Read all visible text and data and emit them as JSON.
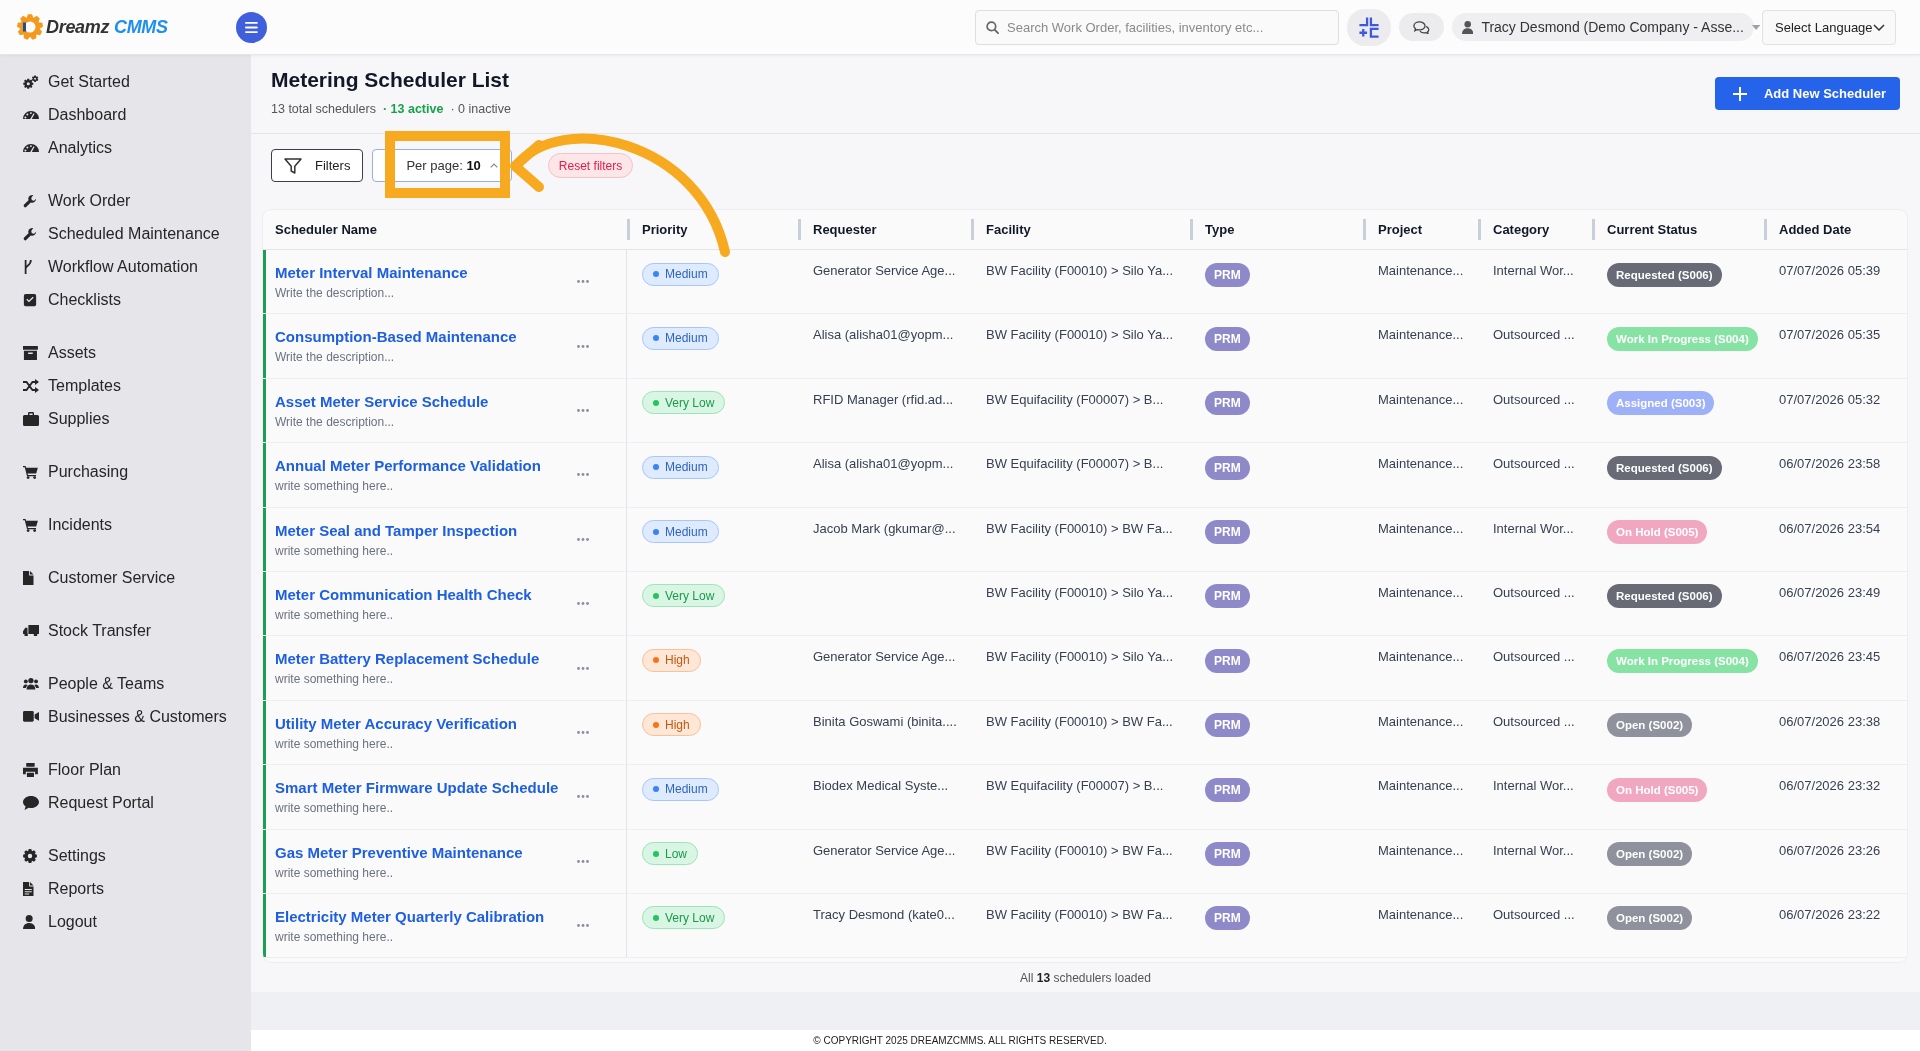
{
  "header": {
    "logo": {
      "name": "Dreamz",
      "accent": "CMMS"
    },
    "search": {
      "placeholder": "Search Work Order, facilities, inventory etc..."
    },
    "user": {
      "name": "Tracy Desmond (Demo Company - Asse..."
    },
    "language": {
      "value": "Select Language"
    }
  },
  "sidebar": {
    "groups": [
      {
        "items": [
          {
            "label": "Get Started"
          },
          {
            "label": "Dashboard"
          },
          {
            "label": "Analytics"
          }
        ]
      },
      {
        "items": [
          {
            "label": "Work Order"
          },
          {
            "label": "Scheduled Maintenance"
          },
          {
            "label": "Workflow Automation"
          },
          {
            "label": "Checklists"
          }
        ]
      },
      {
        "items": [
          {
            "label": "Assets"
          },
          {
            "label": "Templates"
          },
          {
            "label": "Supplies"
          }
        ]
      },
      {
        "items": [
          {
            "label": "Purchasing"
          }
        ]
      },
      {
        "items": [
          {
            "label": "Incidents"
          }
        ]
      },
      {
        "items": [
          {
            "label": "Customer Service"
          }
        ]
      },
      {
        "items": [
          {
            "label": "Stock Transfer"
          }
        ]
      },
      {
        "items": [
          {
            "label": "People & Teams"
          },
          {
            "label": "Businesses & Customers"
          }
        ]
      },
      {
        "items": [
          {
            "label": "Floor Plan"
          },
          {
            "label": "Request Portal"
          }
        ]
      },
      {
        "items": [
          {
            "label": "Settings"
          },
          {
            "label": "Reports"
          },
          {
            "label": "Logout"
          }
        ]
      }
    ]
  },
  "page": {
    "title": "Metering Scheduler List",
    "stats": [
      {
        "kind": "total",
        "text": "13 total schedulers"
      },
      {
        "kind": "active",
        "text": "· 13 active"
      },
      {
        "kind": "inactive",
        "text": "· 0 inactive"
      }
    ],
    "add_button": "Add New Scheduler"
  },
  "toolbar": {
    "filters": "Filters",
    "per_page": "Per page: **10**",
    "reset": "Reset filters"
  },
  "table": {
    "columns": [
      "Scheduler Name",
      "Priority",
      "Requester",
      "Facility",
      "Type",
      "Project",
      "Category",
      "Current Status",
      "Added Date"
    ],
    "rows": [
      {
        "active": true,
        "name": "Meter Interval Maintenance",
        "description": "Write the description...",
        "priority": {
          "label": "Medium",
          "color": "#3b82f6"
        },
        "requester": "Generator Service Age...",
        "facility": "BW Facility (F00010) > Silo Ya...",
        "type": "PRM",
        "project": "Maintenance...",
        "category": "Internal Wor...",
        "status": {
          "label": "Requested (S006)",
          "color": "#686b76"
        },
        "added": "07/07/2026 05:39"
      },
      {
        "active": true,
        "name": "Consumption-Based Maintenance",
        "description": "Write the description...",
        "priority": {
          "label": "Medium",
          "color": "#3b82f6"
        },
        "requester": "Alisa (alisha01@yopm...",
        "facility": "BW Facility (F00010) > Silo Ya...",
        "type": "PRM",
        "project": "Maintenance...",
        "category": "Outsourced ...",
        "status": {
          "label": "Work In Progress (S004)",
          "color": "#86e3a4"
        },
        "added": "07/07/2026 05:35"
      },
      {
        "active": true,
        "name": "Asset Meter Service Schedule",
        "description": "Write the description...",
        "priority": {
          "label": "Very Low",
          "color": "#22c55e"
        },
        "requester": "RFID Manager (rfid.ad...",
        "facility": "BW Equifacility (F00007) > B...",
        "type": "PRM",
        "project": "Maintenance...",
        "category": "Outsourced ...",
        "status": {
          "label": "Assigned (S003)",
          "color": "#9eb1f8"
        },
        "added": "07/07/2026 05:32"
      },
      {
        "active": true,
        "name": "Annual Meter Performance Validation",
        "description": "write something here..",
        "priority": {
          "label": "Medium",
          "color": "#3b82f6"
        },
        "requester": "Alisa (alisha01@yopm...",
        "facility": "BW Equifacility (F00007) > B...",
        "type": "PRM",
        "project": "Maintenance...",
        "category": "Outsourced ...",
        "status": {
          "label": "Requested (S006)",
          "color": "#686b76"
        },
        "added": "06/07/2026 23:58"
      },
      {
        "active": true,
        "name": "Meter Seal and Tamper Inspection",
        "description": "write something here..",
        "priority": {
          "label": "Medium",
          "color": "#3b82f6"
        },
        "requester": "Jacob Mark (gkumar@...",
        "facility": "BW Facility (F00010) > BW Fa...",
        "type": "PRM",
        "project": "Maintenance...",
        "category": "Internal Wor...",
        "status": {
          "label": "On Hold (S005)",
          "color": "#f2a7c0"
        },
        "added": "06/07/2026 23:54"
      },
      {
        "active": true,
        "name": "Meter Communication Health Check",
        "description": "write something here..",
        "priority": {
          "label": "Very Low",
          "color": "#22c55e"
        },
        "facility": "BW Facility (F00010) > Silo Ya...",
        "type": "PRM",
        "project": "Maintenance...",
        "category": "Outsourced ...",
        "status": {
          "label": "Requested (S006)",
          "color": "#686b76"
        },
        "added": "06/07/2026 23:49"
      },
      {
        "active": true,
        "name": "Meter Battery Replacement Schedule",
        "description": "write something here..",
        "priority": {
          "label": "High",
          "color": "#f97316"
        },
        "requester": "Generator Service Age...",
        "facility": "BW Facility (F00010) > Silo Ya...",
        "type": "PRM",
        "project": "Maintenance...",
        "category": "Outsourced ...",
        "status": {
          "label": "Work In Progress (S004)",
          "color": "#86e3a4"
        },
        "added": "06/07/2026 23:45"
      },
      {
        "active": true,
        "name": "Utility Meter Accuracy Verification",
        "description": "write something here..",
        "priority": {
          "label": "High",
          "color": "#f97316"
        },
        "requester": "Binita Goswami (binita....",
        "facility": "BW Facility (F00010) > BW Fa...",
        "type": "PRM",
        "project": "Maintenance...",
        "category": "Outsourced ...",
        "status": {
          "label": "Open (S002)",
          "color": "#8f919c"
        },
        "added": "06/07/2026 23:38"
      },
      {
        "active": true,
        "name": "Smart Meter Firmware Update Schedule",
        "description": "write something here..",
        "priority": {
          "label": "Medium",
          "color": "#3b82f6"
        },
        "requester": "Biodex Medical Syste...",
        "facility": "BW Equifacility (F00007) > B...",
        "type": "PRM",
        "project": "Maintenance...",
        "category": "Internal Wor...",
        "status": {
          "label": "On Hold (S005)",
          "color": "#f2a7c0"
        },
        "added": "06/07/2026 23:32"
      },
      {
        "active": true,
        "name": "Gas Meter Preventive Maintenance",
        "description": "write something here..",
        "priority": {
          "label": "Low",
          "color": "#22c55e"
        },
        "requester": "Generator Service Age...",
        "facility": "BW Facility (F00010) > BW Fa...",
        "type": "PRM",
        "project": "Maintenance...",
        "category": "Internal Wor...",
        "status": {
          "label": "Open (S002)",
          "color": "#8f919c"
        },
        "added": "06/07/2026 23:26"
      },
      {
        "active": true,
        "name": "Electricity Meter Quarterly Calibration",
        "description": "write something here..",
        "priority": {
          "label": "Very Low",
          "color": "#22c55e"
        },
        "requester": "Tracy Desmond (kate0...",
        "facility": "BW Facility (F00010) > BW Fa...",
        "type": "PRM",
        "project": "Maintenance...",
        "category": "Outsourced ...",
        "status": {
          "label": "Open (S002)",
          "color": "#8f919c"
        },
        "added": "06/07/2026 23:22"
      }
    ]
  },
  "footer": {
    "summary": "All **13** schedulers loaded",
    "copyright": "© COPYRIGHT 2025 DREAMZCMMS. ALL RIGHTS RESERVED."
  }
}
